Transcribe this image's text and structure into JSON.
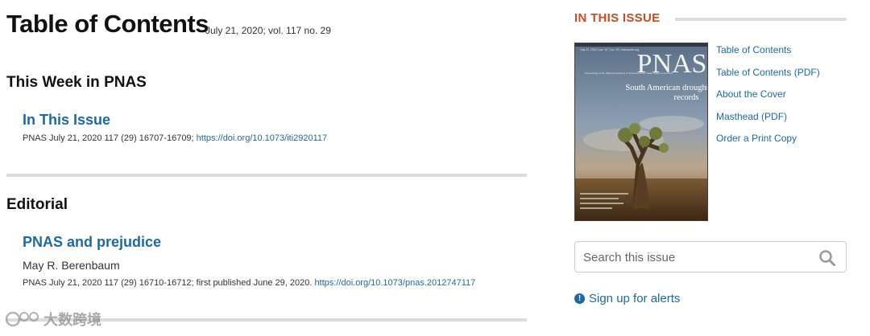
{
  "toc": {
    "title": "Table of Contents",
    "issue_info": "July 21, 2020; vol. 117 no. 29"
  },
  "sections": [
    {
      "heading": "This Week in PNAS",
      "articles": [
        {
          "title": "In This Issue",
          "citation": "PNAS July 21, 2020 117 (29) 16707-16709; ",
          "doi": "https://doi.org/10.1073/iti2920117"
        }
      ]
    },
    {
      "heading": "Editorial",
      "articles": [
        {
          "title": "PNAS and prejudice",
          "authors": "May R. Berenbaum",
          "citation": "PNAS July 21, 2020 117 (29) 16710-16712; first published June 29, 2020. ",
          "doi": "https://doi.org/10.1073/pnas.2012747117"
        }
      ]
    }
  ],
  "sidebar": {
    "heading": "IN THIS ISSUE",
    "cover": {
      "logo": "PNAS",
      "caption_line1": "South American drought",
      "caption_line2": "records"
    },
    "links": [
      "Table of Contents",
      "Table of Contents (PDF)",
      "About the Cover",
      "Masthead (PDF)",
      "Order a Print Copy"
    ],
    "search": {
      "placeholder": "Search this issue"
    },
    "alerts_label": "Sign up for alerts"
  },
  "watermark": {
    "text": "大数跨境"
  },
  "colors": {
    "link": "#1b6aa5",
    "accent": "#cc4a1f",
    "divider": "#dcdcdc"
  }
}
